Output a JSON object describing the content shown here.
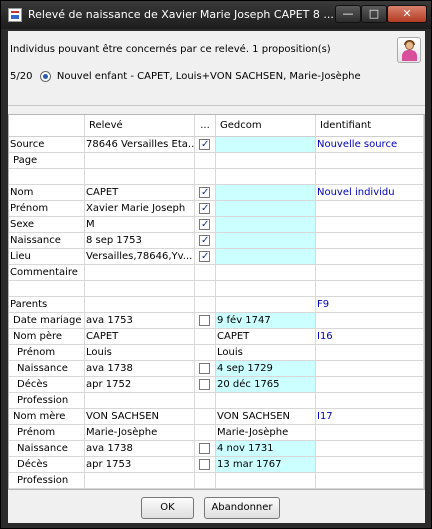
{
  "window": {
    "title": "Relevé de naissance de Xavier Marie Joseph CAPET 8 ..."
  },
  "info": {
    "text": "Individus pouvant être concernés par ce relevé. 1 proposition(s)",
    "proposition": {
      "index": "5/20",
      "label": "Nouvel enfant - CAPET, Louis+VON SACHSEN, Marie-Josèphe"
    }
  },
  "table": {
    "headers": {
      "c1": "Relevé",
      "c2": "...",
      "c3": "Gedcom",
      "c4": "Identifiant"
    },
    "rows": [
      {
        "label": "Source",
        "releve": "78646 Versailles Eta...",
        "check": "checked",
        "gedcom": "",
        "ident": "Nouvelle source",
        "cyan": true
      },
      {
        "label": "Page",
        "releve": "",
        "check": "",
        "gedcom": "",
        "ident": "",
        "cyan": false
      },
      {
        "label": "",
        "releve": "",
        "check": "",
        "gedcom": "",
        "ident": "",
        "cyan": false
      },
      {
        "label": "Nom",
        "releve": "CAPET",
        "check": "checked",
        "gedcom": "",
        "ident": "Nouvel individu",
        "cyan": true
      },
      {
        "label": "Prénom",
        "releve": "Xavier Marie Joseph",
        "check": "checked",
        "gedcom": "",
        "ident": "",
        "cyan": true
      },
      {
        "label": "Sexe",
        "releve": "M",
        "check": "checked",
        "gedcom": "",
        "ident": "",
        "cyan": true
      },
      {
        "label": "Naissance",
        "releve": "8 sep 1753",
        "check": "checked",
        "gedcom": "",
        "ident": "",
        "cyan": true
      },
      {
        "label": "Lieu",
        "releve": "Versailles,78646,Yv...",
        "check": "checked",
        "gedcom": "",
        "ident": "",
        "cyan": true
      },
      {
        "label": "Commentaire",
        "releve": "",
        "check": "",
        "gedcom": "",
        "ident": "",
        "cyan": false
      },
      {
        "label": "",
        "releve": "",
        "check": "",
        "gedcom": "",
        "ident": "",
        "cyan": false
      },
      {
        "label": "Parents",
        "releve": "",
        "check": "",
        "gedcom": "",
        "ident": "F9",
        "cyan": false
      },
      {
        "label": "Date mariage",
        "releve": "ava 1753",
        "check": "unchecked",
        "gedcom": "9 fév 1747",
        "ident": "",
        "cyan": true
      },
      {
        "label": "Nom père",
        "releve": "CAPET",
        "check": "",
        "gedcom": "CAPET",
        "ident": "I16",
        "cyan": false
      },
      {
        "label": "Prénom",
        "releve": "Louis",
        "check": "",
        "gedcom": "Louis",
        "ident": "",
        "cyan": false
      },
      {
        "label": "Naissance",
        "releve": "ava 1738",
        "check": "unchecked",
        "gedcom": "4 sep 1729",
        "ident": "",
        "cyan": true
      },
      {
        "label": "Décès",
        "releve": "apr 1752",
        "check": "unchecked",
        "gedcom": "20 déc 1765",
        "ident": "",
        "cyan": true
      },
      {
        "label": "Profession",
        "releve": "",
        "check": "",
        "gedcom": "",
        "ident": "",
        "cyan": false
      },
      {
        "label": "Nom mère",
        "releve": "VON SACHSEN",
        "check": "",
        "gedcom": "VON SACHSEN",
        "ident": "I17",
        "cyan": false
      },
      {
        "label": "Prénom",
        "releve": "Marie-Josèphe",
        "check": "",
        "gedcom": "Marie-Josèphe",
        "ident": "",
        "cyan": false
      },
      {
        "label": "Naissance",
        "releve": "ava 1738",
        "check": "unchecked",
        "gedcom": "4 nov 1731",
        "ident": "",
        "cyan": true
      },
      {
        "label": "Décès",
        "releve": "apr 1753",
        "check": "unchecked",
        "gedcom": "13 mar 1767",
        "ident": "",
        "cyan": true
      },
      {
        "label": "Profession",
        "releve": "",
        "check": "",
        "gedcom": "",
        "ident": "",
        "cyan": false
      }
    ]
  },
  "buttons": {
    "ok": "OK",
    "cancel": "Abandonner"
  },
  "colors": {
    "cyan_field": "#ccffff",
    "link": "#0000c0"
  },
  "icons": {
    "app": "app-icon",
    "person": "person-icon"
  }
}
